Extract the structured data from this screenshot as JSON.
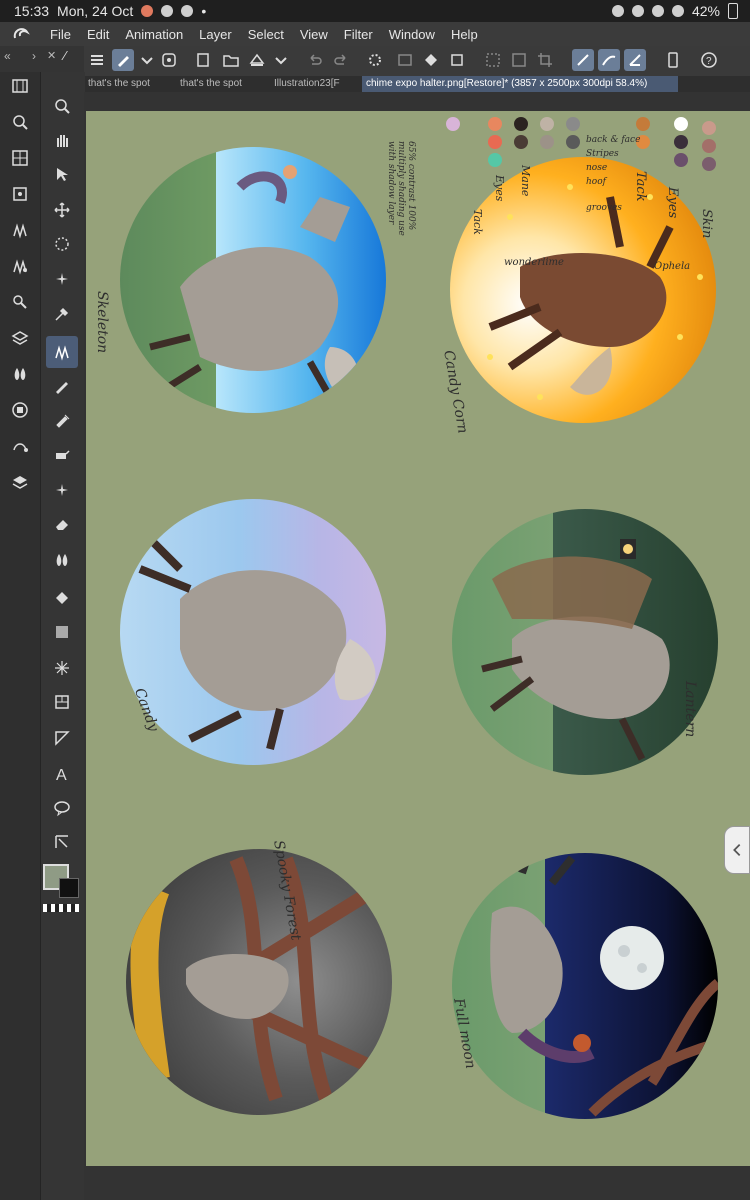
{
  "status": {
    "time": "15:33",
    "date": "Mon, 24 Oct",
    "battery": "42%"
  },
  "menu": [
    "File",
    "Edit",
    "Animation",
    "Layer",
    "Select",
    "View",
    "Filter",
    "Window",
    "Help"
  ],
  "tabs": [
    {
      "label": "that's the spot"
    },
    {
      "label": "that's the spot"
    },
    {
      "label": "Illustration23[F"
    },
    {
      "label": "chime expo halter.png[Restore]* (3857 x 2500px 300dpi 58.4%)"
    }
  ],
  "artwork_labels": {
    "skeleton": "Skeleton",
    "candycorn": "Candy Corn",
    "candy": "Candy",
    "lantern": "Lantern",
    "spooky": "Spooky Forest",
    "fullmoon": "Full moon"
  },
  "palette_notes": {
    "tack": "Tack",
    "eyes": "Eyes",
    "mane": "Mane",
    "skin": "Skin",
    "leyes": "Eyes",
    "ltack": "Tack",
    "stripes": "Stripes",
    "nose": "nose",
    "hoof": "hoof",
    "back": "back & face",
    "grooves": "grooves",
    "wonderlime": "wonderlime",
    "ophelia": "Ophela",
    "note": "65% contrast 100% multiply shading use with shadow layer"
  },
  "colors": {
    "canvas": "#96a27a",
    "accent": "#6b7e98"
  }
}
